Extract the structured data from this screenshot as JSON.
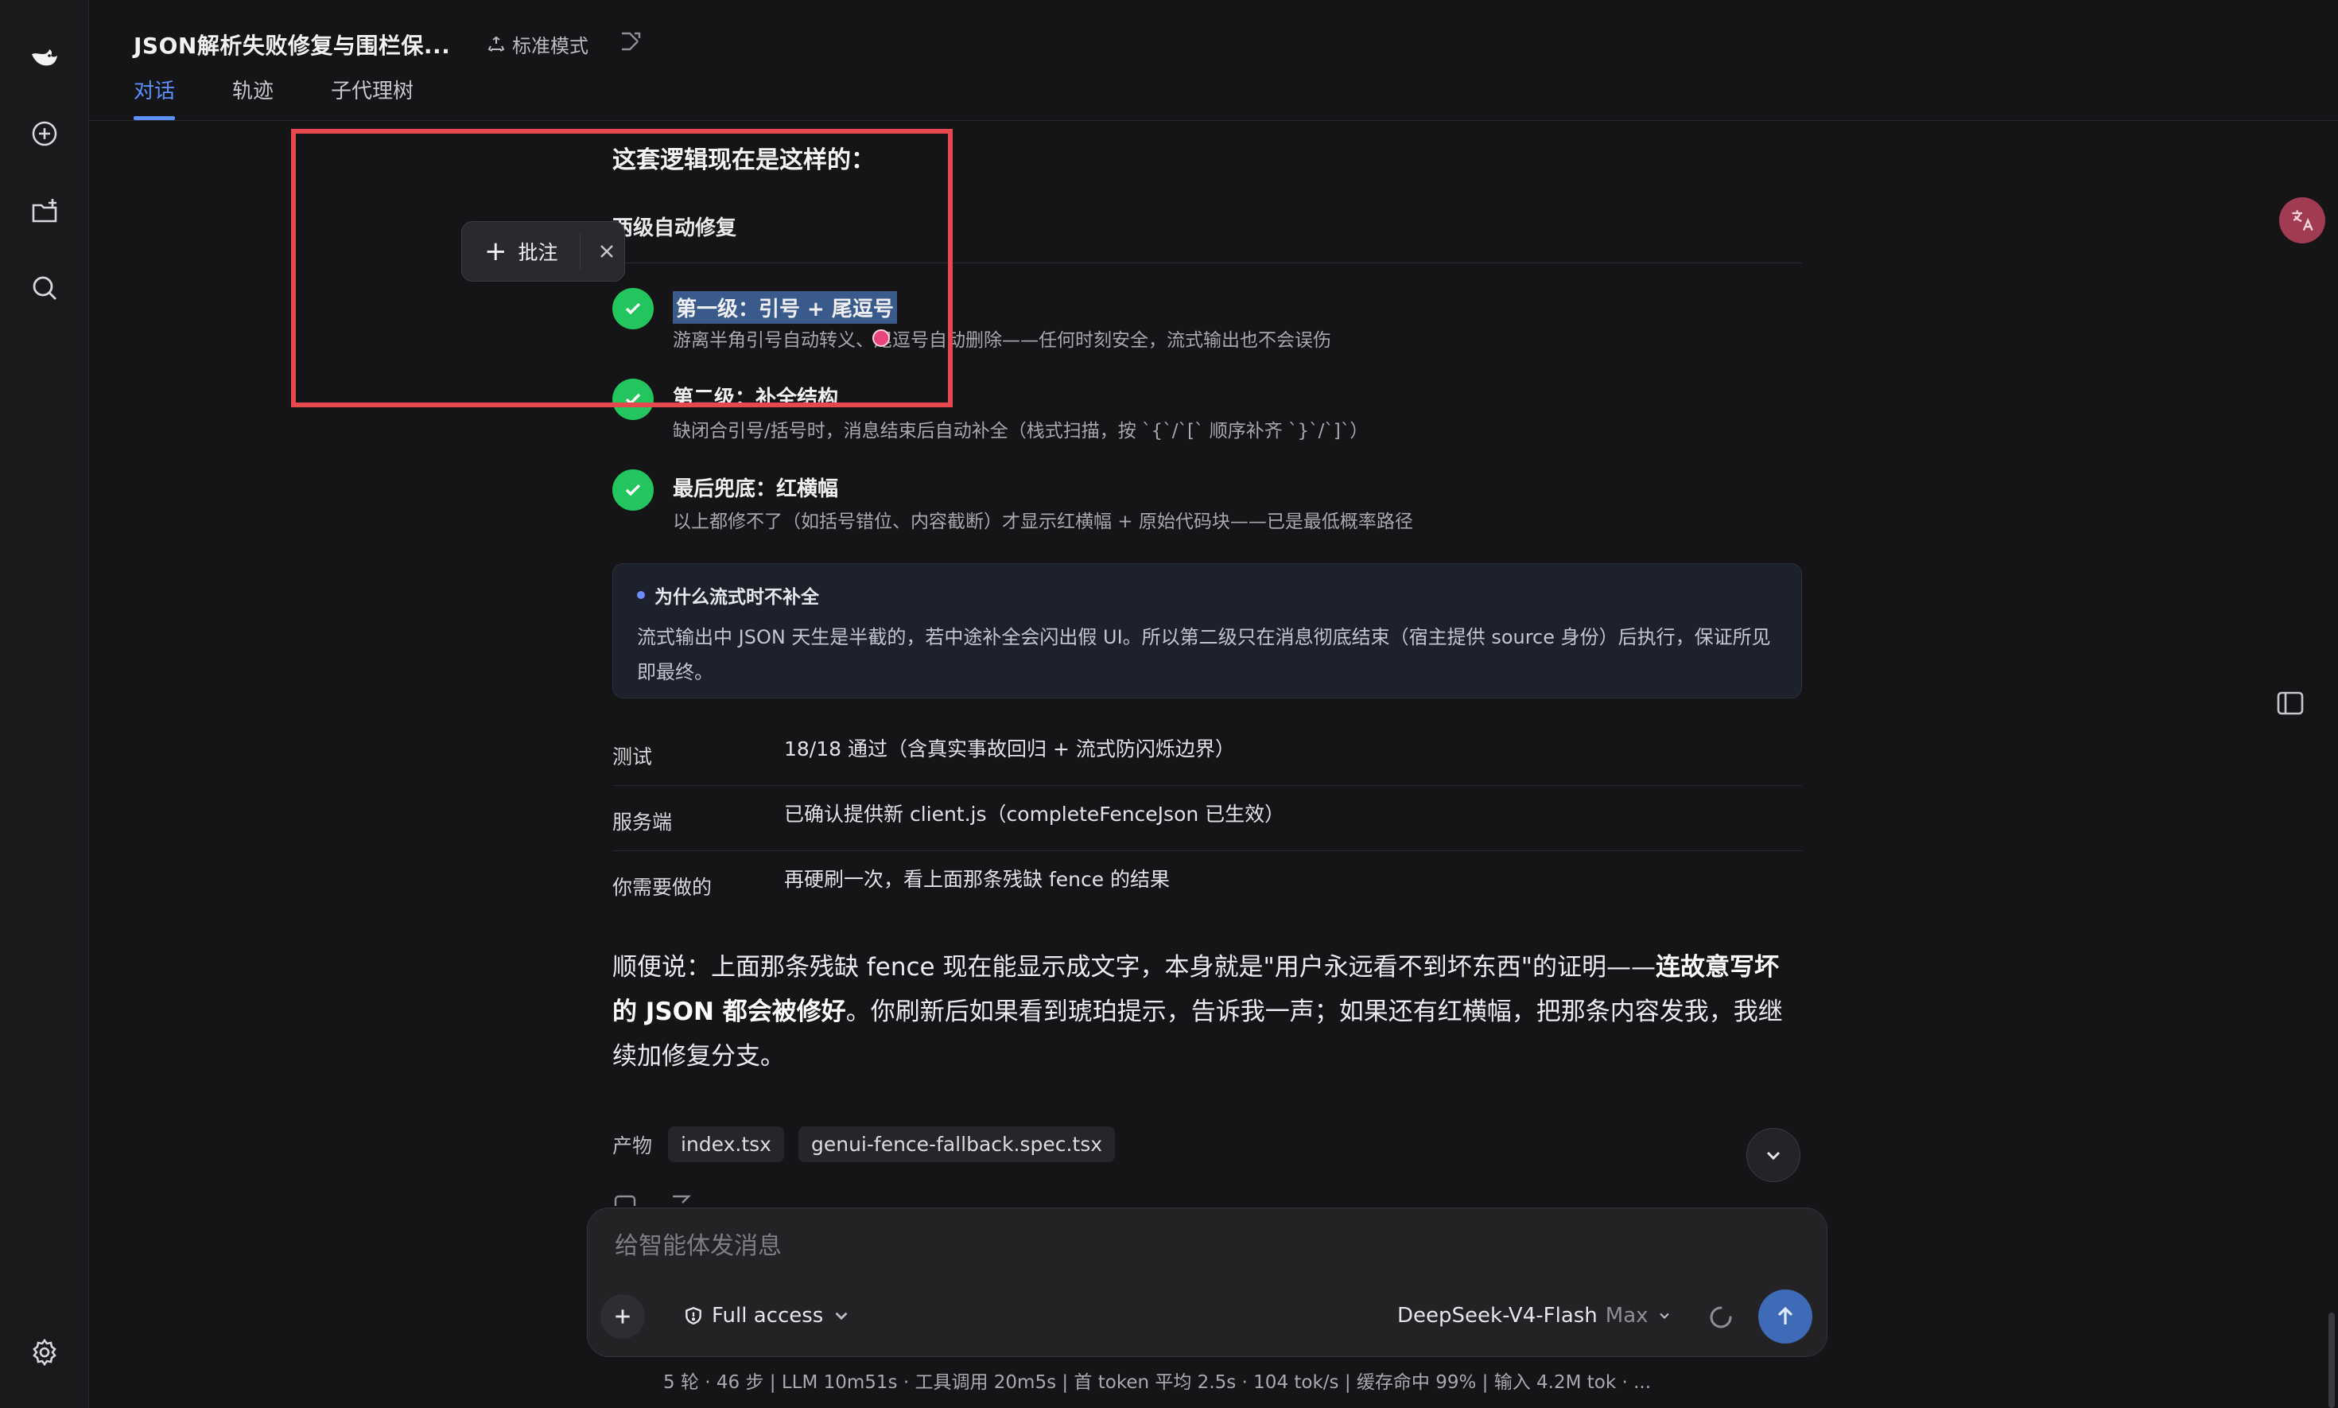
{
  "header": {
    "title": "JSON解析失败修复与围栏保...",
    "mode_label": "标准模式",
    "tabs": [
      "对话",
      "轨迹",
      "子代理树"
    ]
  },
  "sidebar": {
    "icons": [
      "deepseek-logo-icon",
      "new-chat-icon",
      "new-project-icon",
      "search-icon",
      "settings-icon"
    ]
  },
  "annotation": {
    "add_label": "批注"
  },
  "message": {
    "heading": "这套逻辑现在是这样的：",
    "subheading": "两级自动修复",
    "steps": [
      {
        "title": "第一级：引号 + 尾逗号",
        "desc": "游离半角引号自动转义、尾逗号自动删除——任何时刻安全，流式输出也不会误伤"
      },
      {
        "title": "第二级：补全结构",
        "desc": "缺闭合引号/括号时，消息结束后自动补全（栈式扫描，按 `{`/`[` 顺序补齐 `}`/`]`）"
      },
      {
        "title": "最后兜底：红横幅",
        "desc": "以上都修不了（如括号错位、内容截断）才显示红横幅 + 原始代码块——已是最低概率路径"
      }
    ],
    "note": {
      "title": "为什么流式时不补全",
      "body": "流式输出中 JSON 天生是半截的，若中途补全会闪出假 UI。所以第二级只在消息彻底结束（宿主提供 source 身份）后执行，保证所见即最终。"
    },
    "table": [
      {
        "key": "测试",
        "value": "18/18 通过（含真实事故回归 + 流式防闪烁边界）"
      },
      {
        "key": "服务端",
        "value": "已确认提供新 client.js（completeFenceJson 已生效）"
      },
      {
        "key": "你需要做的",
        "value": "再硬刷一次，看上面那条残缺 fence 的结果"
      }
    ],
    "para_pre": "顺便说：上面那条残缺 fence 现在能显示成文字，本身就是\"用户永远看不到坏东西\"的证明——",
    "para_bold": "连故意写坏的 JSON 都会被修好",
    "para_post": "。你刷新后如果看到琥珀提示，告诉我一声；如果还有红横幅，把那条内容发我，我继续加修复分支。",
    "products_label": "产物",
    "products": [
      "index.tsx",
      "genui-fence-fallback.spec.tsx"
    ]
  },
  "composer": {
    "placeholder": "给智能体发消息",
    "access_label": "Full access",
    "model_name": "DeepSeek-V4-Flash",
    "model_tier": "Max"
  },
  "stats": "5 轮 · 46 步  |  LLM 10m51s · 工具调用 20m5s  |  首 token 平均 2.5s · 104 tok/s  |  缓存命中 99%  |  输入 4.2M tok · ...",
  "colors": {
    "accent": "#5b8ff9",
    "success": "#22c55e",
    "annotation_border": "#e5484d",
    "send_button": "#3f6ab8"
  }
}
